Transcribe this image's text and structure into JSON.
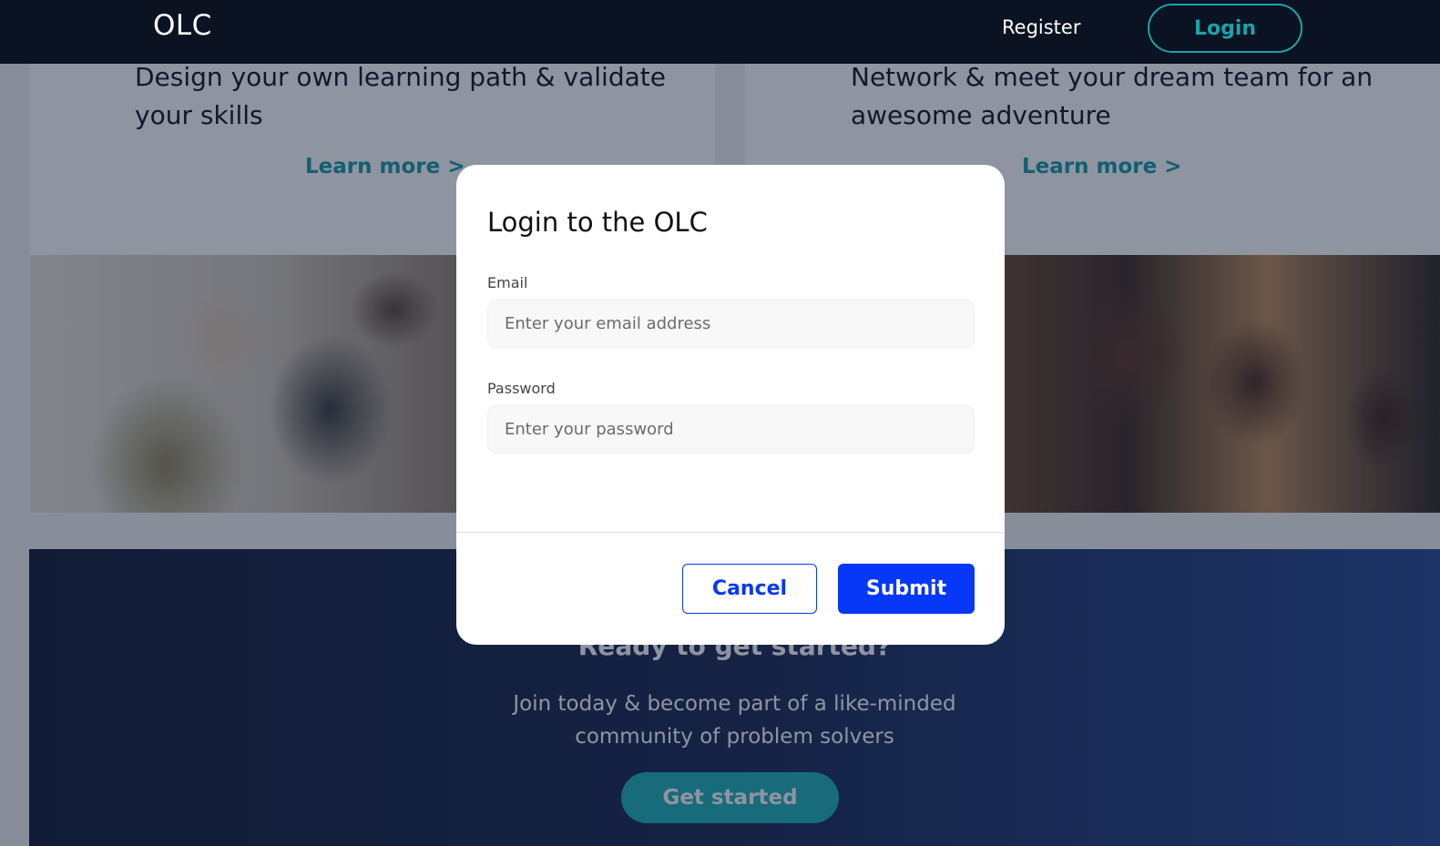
{
  "navbar": {
    "brand": "OLC",
    "register_label": "Register",
    "login_label": "Login"
  },
  "cards": [
    {
      "text": "Design your own learning path & validate your skills",
      "link": "Learn more >"
    },
    {
      "text": "Network & meet your dream team for an awesome adventure",
      "link": "Learn more >"
    }
  ],
  "cta": {
    "title": "Ready to get started?",
    "subtitle_line1": "Join today & become part of a like-minded",
    "subtitle_line2": "community of problem solvers",
    "button_label": "Get started"
  },
  "modal": {
    "title": "Login to the OLC",
    "email_label": "Email",
    "email_placeholder": "Enter your email address",
    "email_value": "",
    "password_label": "Password",
    "password_placeholder": "Enter your password",
    "password_value": "",
    "cancel_label": "Cancel",
    "submit_label": "Submit"
  },
  "colors": {
    "navbar_bg": "#0b1222",
    "accent_teal": "#1ba3a9",
    "submit_blue": "#0838f7"
  }
}
